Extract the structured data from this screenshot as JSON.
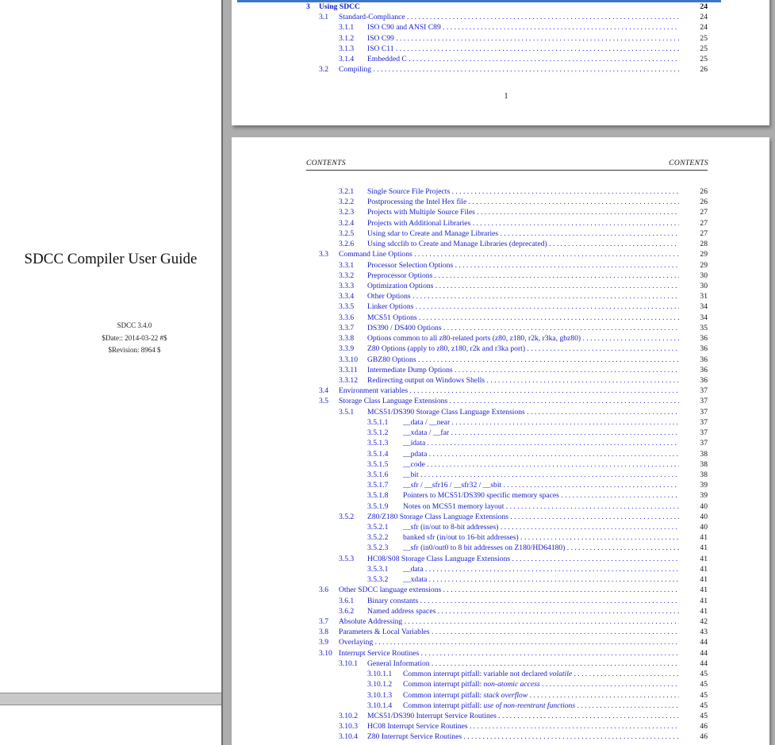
{
  "cover": {
    "title": "SDCC Compiler User Guide",
    "version": "SDCC 3.4.0",
    "date": "$Date:: 2014-03-22 #$",
    "revision": "$Revision: 8964 $"
  },
  "page1": {
    "page_number": "1",
    "entries": [
      {
        "num": "3",
        "title": "Using SDCC",
        "page": "24",
        "level": 0
      },
      {
        "num": "3.1",
        "title": "Standard-Compliance",
        "page": "24",
        "level": 1
      },
      {
        "num": "3.1.1",
        "title": "ISO C90 and ANSI C89",
        "page": "24",
        "level": 2
      },
      {
        "num": "3.1.2",
        "title": "ISO C99",
        "page": "25",
        "level": 2
      },
      {
        "num": "3.1.3",
        "title": "ISO C11",
        "page": "25",
        "level": 2
      },
      {
        "num": "3.1.4",
        "title": "Embedded C",
        "page": "25",
        "level": 2
      },
      {
        "num": "3.2",
        "title": "Compiling",
        "page": "26",
        "level": 1
      }
    ]
  },
  "page2": {
    "running_head_left": "CONTENTS",
    "running_head_right": "CONTENTS",
    "entries": [
      {
        "num": "3.2.1",
        "title": "Single Source File Projects",
        "page": "26",
        "level": 2
      },
      {
        "num": "3.2.2",
        "title": "Postprocessing the Intel Hex file",
        "page": "26",
        "level": 2
      },
      {
        "num": "3.2.3",
        "title": "Projects with Multiple Source Files",
        "page": "27",
        "level": 2
      },
      {
        "num": "3.2.4",
        "title": "Projects with Additional Libraries",
        "page": "27",
        "level": 2
      },
      {
        "num": "3.2.5",
        "title": "Using sdar to Create and Manage Libraries",
        "page": "27",
        "level": 2
      },
      {
        "num": "3.2.6",
        "title": "Using sdcclib to Create and Manage Libraries (deprecated)",
        "page": "28",
        "level": 2
      },
      {
        "num": "3.3",
        "title": "Command Line Options",
        "page": "29",
        "level": 1
      },
      {
        "num": "3.3.1",
        "title": "Processor Selection Options",
        "page": "29",
        "level": 2
      },
      {
        "num": "3.3.2",
        "title": "Preprocessor Options",
        "page": "30",
        "level": 2
      },
      {
        "num": "3.3.3",
        "title": "Optimization Options",
        "page": "30",
        "level": 2
      },
      {
        "num": "3.3.4",
        "title": "Other Options",
        "page": "31",
        "level": 2
      },
      {
        "num": "3.3.5",
        "title": "Linker Options",
        "page": "34",
        "level": 2
      },
      {
        "num": "3.3.6",
        "title": "MCS51 Options",
        "page": "34",
        "level": 2
      },
      {
        "num": "3.3.7",
        "title": "DS390 / DS400 Options",
        "page": "35",
        "level": 2
      },
      {
        "num": "3.3.8",
        "title": "Options common to all z80-related ports (z80, z180, r2k, r3ka, gbz80)",
        "page": "36",
        "level": 2
      },
      {
        "num": "3.3.9",
        "title": "Z80 Options (apply to z80, z180, r2k and r3ka port)",
        "page": "36",
        "level": 2
      },
      {
        "num": "3.3.10",
        "title": "GBZ80 Options",
        "page": "36",
        "level": 2
      },
      {
        "num": "3.3.11",
        "title": "Intermediate Dump Options",
        "page": "36",
        "level": 2
      },
      {
        "num": "3.3.12",
        "title": "Redirecting output on Windows Shells",
        "page": "36",
        "level": 2
      },
      {
        "num": "3.4",
        "title": "Environment variables",
        "page": "37",
        "level": 1
      },
      {
        "num": "3.5",
        "title": "Storage Class Language Extensions",
        "page": "37",
        "level": 1
      },
      {
        "num": "3.5.1",
        "title": "MCS51/DS390 Storage Class Language Extensions",
        "page": "37",
        "level": 2
      },
      {
        "num": "3.5.1.1",
        "title": "__data / __near",
        "page": "37",
        "level": 3
      },
      {
        "num": "3.5.1.2",
        "title": "__xdata / __far",
        "page": "37",
        "level": 3
      },
      {
        "num": "3.5.1.3",
        "title": "__idata",
        "page": "37",
        "level": 3
      },
      {
        "num": "3.5.1.4",
        "title": "__pdata",
        "page": "38",
        "level": 3
      },
      {
        "num": "3.5.1.5",
        "title": "__code",
        "page": "38",
        "level": 3
      },
      {
        "num": "3.5.1.6",
        "title": "__bit",
        "page": "38",
        "level": 3
      },
      {
        "num": "3.5.1.7",
        "title": "__sfr / __sfr16 / __sfr32 / __sbit",
        "page": "39",
        "level": 3
      },
      {
        "num": "3.5.1.8",
        "title": "Pointers to MCS51/DS390 specific memory spaces",
        "page": "39",
        "level": 3
      },
      {
        "num": "3.5.1.9",
        "title": "Notes on MCS51 memory layout",
        "page": "40",
        "level": 3
      },
      {
        "num": "3.5.2",
        "title": "Z80/Z180 Storage Class Language Extensions",
        "page": "40",
        "level": 2
      },
      {
        "num": "3.5.2.1",
        "title": "__sfr (in/out to 8-bit addresses)",
        "page": "40",
        "level": 3
      },
      {
        "num": "3.5.2.2",
        "title": "banked sfr (in/out to 16-bit addresses)",
        "page": "41",
        "level": 3
      },
      {
        "num": "3.5.2.3",
        "title": "__sfr (in0/out0 to 8 bit addresses on Z180/HD64180)",
        "page": "41",
        "level": 3
      },
      {
        "num": "3.5.3",
        "title": "HC08/S08 Storage Class Language Extensions",
        "page": "41",
        "level": 2
      },
      {
        "num": "3.5.3.1",
        "title": "__data",
        "page": "41",
        "level": 3
      },
      {
        "num": "3.5.3.2",
        "title": "__xdata",
        "page": "41",
        "level": 3
      },
      {
        "num": "3.6",
        "title": "Other SDCC language extensions",
        "page": "41",
        "level": 1
      },
      {
        "num": "3.6.1",
        "title": "Binary constants",
        "page": "41",
        "level": 2
      },
      {
        "num": "3.6.2",
        "title": "Named address spaces",
        "page": "41",
        "level": 2
      },
      {
        "num": "3.7",
        "title": "Absolute Addressing",
        "page": "42",
        "level": 1
      },
      {
        "num": "3.8",
        "title": "Parameters & Local Variables",
        "page": "43",
        "level": 1
      },
      {
        "num": "3.9",
        "title": "Overlaying",
        "page": "44",
        "level": 1
      },
      {
        "num": "3.10",
        "title": "Interrupt Service Routines",
        "page": "44",
        "level": 1
      },
      {
        "num": "3.10.1",
        "title": "General Information",
        "page": "44",
        "level": 2
      },
      {
        "num": "3.10.1.1",
        "title": "Common interrupt pitfall: variable not declared ",
        "title_em": "volatile",
        "page": "45",
        "level": 3
      },
      {
        "num": "3.10.1.2",
        "title": "Common interrupt pitfall: ",
        "title_em": "non-atomic access",
        "page": "45",
        "level": 3
      },
      {
        "num": "3.10.1.3",
        "title": "Common interrupt pitfall: ",
        "title_em": "stack overflow",
        "page": "45",
        "level": 3
      },
      {
        "num": "3.10.1.4",
        "title": "Common interrupt pitfall: ",
        "title_em": "use of non-reentrant functions",
        "page": "45",
        "level": 3
      },
      {
        "num": "3.10.2",
        "title": "MCS51/DS390 Interrupt Service Routines",
        "page": "45",
        "level": 2
      },
      {
        "num": "3.10.3",
        "title": "HC08 Interrupt Service Routines",
        "page": "46",
        "level": 2
      },
      {
        "num": "3.10.4",
        "title": "Z80 Interrupt Service Routines",
        "page": "46",
        "level": 2
      }
    ]
  }
}
